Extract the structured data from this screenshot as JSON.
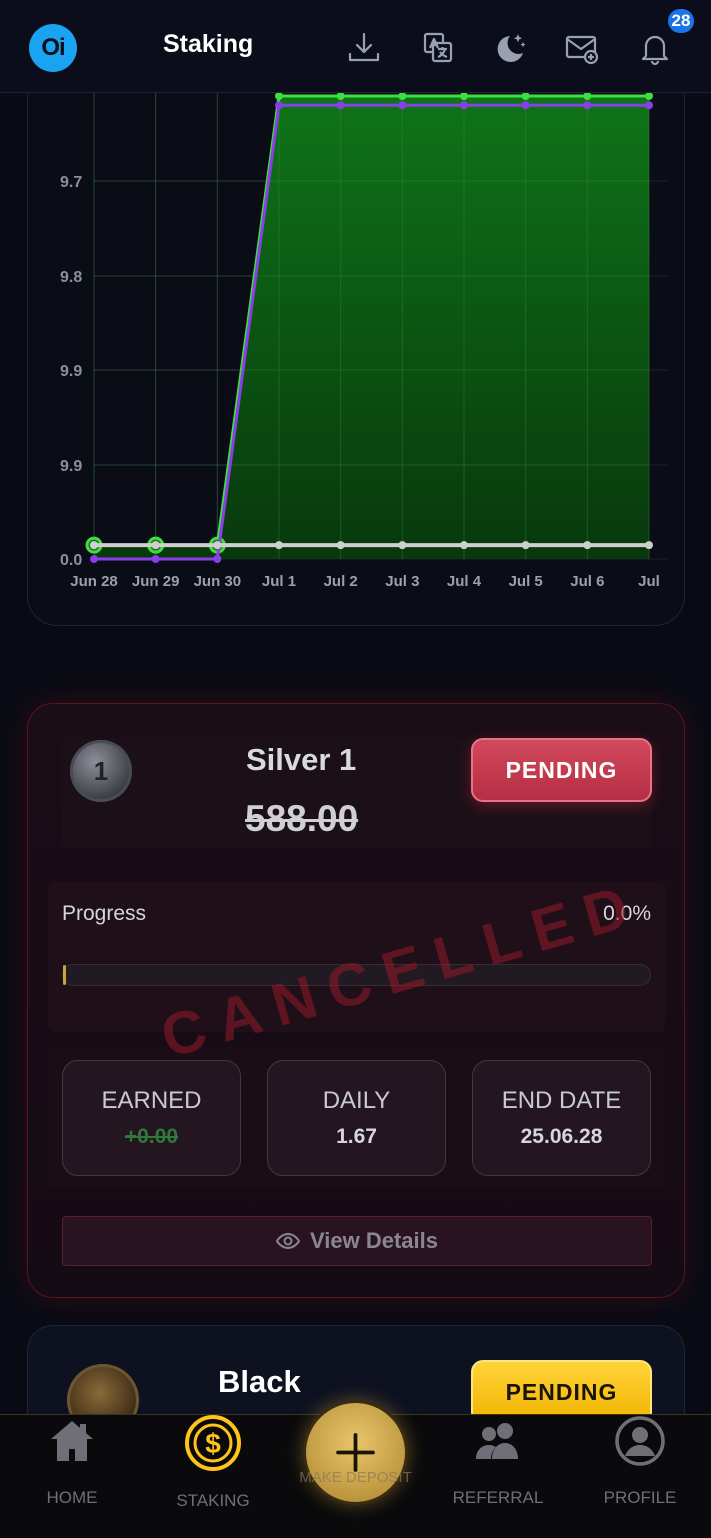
{
  "header": {
    "logo_text": "Oi",
    "title": "Staking",
    "notification_count": "28",
    "icons": [
      "download-icon",
      "translate-icon",
      "moon-stars-icon",
      "mail-add-icon",
      "bell-icon"
    ]
  },
  "chart_data": {
    "type": "line",
    "x": [
      "Jun 28",
      "Jun 29",
      "Jun 30",
      "Jul 1",
      "Jul 2",
      "Jul 3",
      "Jul 4",
      "Jul 5",
      "Jul 6",
      "Jul"
    ],
    "y_tick_labels": [
      "9.7",
      "9.8",
      "9.9",
      "9.9",
      "0.0"
    ],
    "series": [
      {
        "color": "#3ee03e",
        "fill": "#0e6a14",
        "values": [
          0.3,
          0.3,
          0.3,
          10,
          10,
          10,
          10,
          10,
          10,
          10
        ]
      },
      {
        "color": "#8a3ee8",
        "values": [
          0,
          0,
          0,
          9.8,
          9.8,
          9.8,
          9.8,
          9.8,
          9.8,
          9.8
        ]
      },
      {
        "color": "#cfcfcf",
        "values": [
          0.3,
          0.3,
          0.3,
          0.3,
          0.3,
          0.3,
          0.3,
          0.3,
          0.3,
          0.3
        ]
      }
    ]
  },
  "silver": {
    "name": "Silver 1",
    "medal_number": "1",
    "amount": "588.00",
    "status": "PENDING",
    "progress_label": "Progress",
    "progress_value": "0.0%",
    "progress_fraction": 0.0,
    "stamp": "CANCELLED",
    "earned_label": "EARNED",
    "earned_value": "+0.00",
    "daily_label": "DAILY",
    "daily_value": "1.67",
    "end_label": "END DATE",
    "end_value": "25.06.28",
    "view_details": "View Details"
  },
  "black": {
    "name": "Black",
    "status": "PENDING"
  },
  "nav": {
    "home": "HOME",
    "staking": "STAKING",
    "deposit": "MAKE DEPOSIT",
    "referral": "REFERRAL",
    "profile": "PROFILE"
  }
}
